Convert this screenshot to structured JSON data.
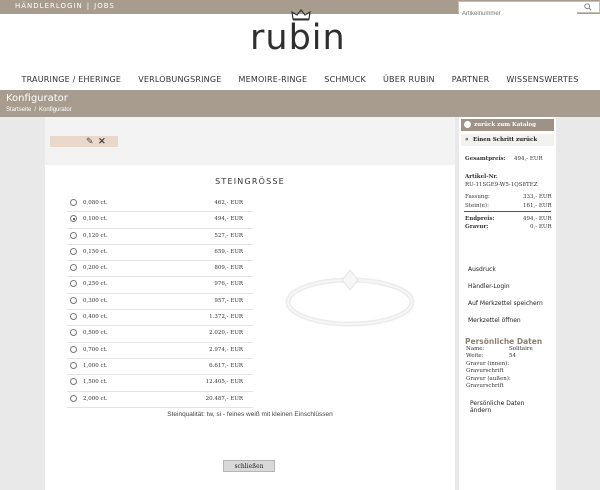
{
  "topbar": {
    "links": [
      "HÄNDLERLOGIN",
      "JOBS"
    ],
    "separator": "|",
    "search_placeholder": "Artikelnummer"
  },
  "brand": {
    "logo_text": "rubin"
  },
  "nav": [
    "TRAURINGE / EHERINGE",
    "VERLOBUNGSRINGE",
    "MEMOIRE-RINGE",
    "SCHMUCK",
    "ÜBER RUBIN",
    "PARTNER",
    "WISSENSWERTES"
  ],
  "page": {
    "title": "Konfigurator",
    "breadcrumb": [
      "Startseite",
      "Konfigurator"
    ],
    "breadcrumb_sep": "/"
  },
  "right_panel": {
    "back_to_catalog": "zurück zum Katalog",
    "step_back": "Einen Schritt zurück",
    "total_label": "Gesamtpreis:",
    "total_value": "494,- EUR",
    "article_label": "Artikel-Nr.",
    "article_number": "RU-11SGE9-W5-1QS8TEZ",
    "rows": [
      {
        "label": "Fassung:",
        "value": "333,- EUR"
      },
      {
        "label": "Stein(e):",
        "value": "161,- EUR"
      }
    ],
    "final_rows": [
      {
        "label": "Endpreis:",
        "value": "494,- EUR"
      },
      {
        "label": "Gravur:",
        "value": "0,- EUR"
      }
    ],
    "buttons": [
      "Ausdruck",
      "Händler-Login",
      "Auf Merkzettel speichern",
      "Merkzettel öffnen"
    ],
    "personal_title": "Persönliche Daten",
    "personal_rows": [
      {
        "label": "Name:",
        "value": "Solitaire"
      },
      {
        "label": "Weite:",
        "value": "54"
      },
      {
        "label": "Gravur (innen):",
        "value": ""
      },
      {
        "label": "Gravurschrift",
        "value": ""
      },
      {
        "label": "Gravur (außen):",
        "value": ""
      },
      {
        "label": "Gravurschrift",
        "value": ""
      }
    ],
    "personal_change": "Persönliche Daten ändern"
  },
  "modal": {
    "title": "STEINGRÖSSE",
    "options": [
      {
        "ct": "0,080 ct.",
        "price": "462,- EUR",
        "selected": false
      },
      {
        "ct": "0,100 ct.",
        "price": "494,- EUR",
        "selected": true
      },
      {
        "ct": "0,120 ct.",
        "price": "527,- EUR",
        "selected": false
      },
      {
        "ct": "0,150 ct.",
        "price": "659,- EUR",
        "selected": false
      },
      {
        "ct": "0,200 ct.",
        "price": "809,- EUR",
        "selected": false
      },
      {
        "ct": "0,250 ct.",
        "price": "976,- EUR",
        "selected": false
      },
      {
        "ct": "0,300 ct.",
        "price": "957,- EUR",
        "selected": false
      },
      {
        "ct": "0,400 ct.",
        "price": "1.372,- EUR",
        "selected": false
      },
      {
        "ct": "0,500 ct.",
        "price": "2.020,- EUR",
        "selected": false
      },
      {
        "ct": "0,700 ct.",
        "price": "2.974,- EUR",
        "selected": false
      },
      {
        "ct": "1,000 ct.",
        "price": "6.617,- EUR",
        "selected": false
      },
      {
        "ct": "1,500 ct.",
        "price": "12.405,- EUR",
        "selected": false
      },
      {
        "ct": "2,000 ct.",
        "price": "20.487,- EUR",
        "selected": false
      }
    ],
    "quality": "Steinqualität: tw, si - feines weiß mit kleinen Einschlüssen",
    "close_label": "schließen"
  },
  "colors": {
    "brand_bar": "#a89c8e",
    "chip": "#ead9cb",
    "accent_text": "#8a7f72"
  }
}
